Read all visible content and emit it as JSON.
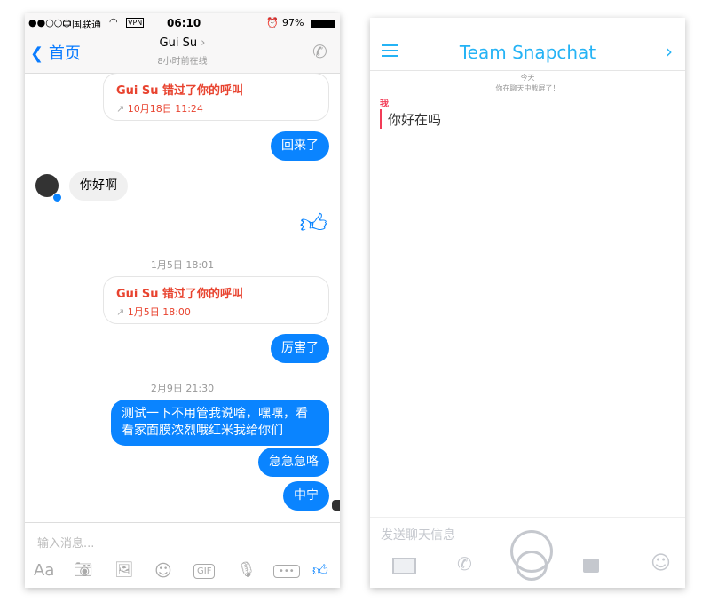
{
  "messenger": {
    "status": {
      "signal": "●●○○○",
      "carrier": "中国联通",
      "vpn": "VPN",
      "time": "06:10",
      "battery": "97%"
    },
    "nav": {
      "back": "首页",
      "title": "Gui Su",
      "subtitle": "8小时前在线"
    },
    "messages": [
      {
        "type": "missed_call",
        "title": "Gui Su 错过了你的呼叫",
        "time": "10月18日 11:24"
      },
      {
        "type": "me",
        "text": "回来了"
      },
      {
        "type": "them",
        "text": "你好啊"
      },
      {
        "type": "like"
      },
      {
        "type": "timestamp",
        "text": "1月5日 18:01"
      },
      {
        "type": "missed_call",
        "title": "Gui Su 错过了你的呼叫",
        "time": "1月5日 18:00"
      },
      {
        "type": "me",
        "text": "厉害了"
      },
      {
        "type": "timestamp",
        "text": "2月9日 21:30"
      },
      {
        "type": "me",
        "text": "测试一下不用管我说啥，嘿嘿，看看家面膜浓烈哦红米我给你们"
      },
      {
        "type": "me",
        "text": "急急急咯"
      },
      {
        "type": "me",
        "text": "中宁"
      }
    ],
    "input_placeholder": "输入消息...",
    "toolbar": {
      "aa": "Aa",
      "gif": "GIF"
    },
    "accent": "#0a84ff",
    "missed_color": "#e8432f"
  },
  "snapchat": {
    "title": "Team Snapchat",
    "date": "今天",
    "notice": "你在聊天中截屏了！",
    "sender": "我",
    "message": "你好在吗",
    "input_placeholder": "发送聊天信息",
    "accent": "#25b3f5",
    "sender_color": "#f23c57"
  }
}
